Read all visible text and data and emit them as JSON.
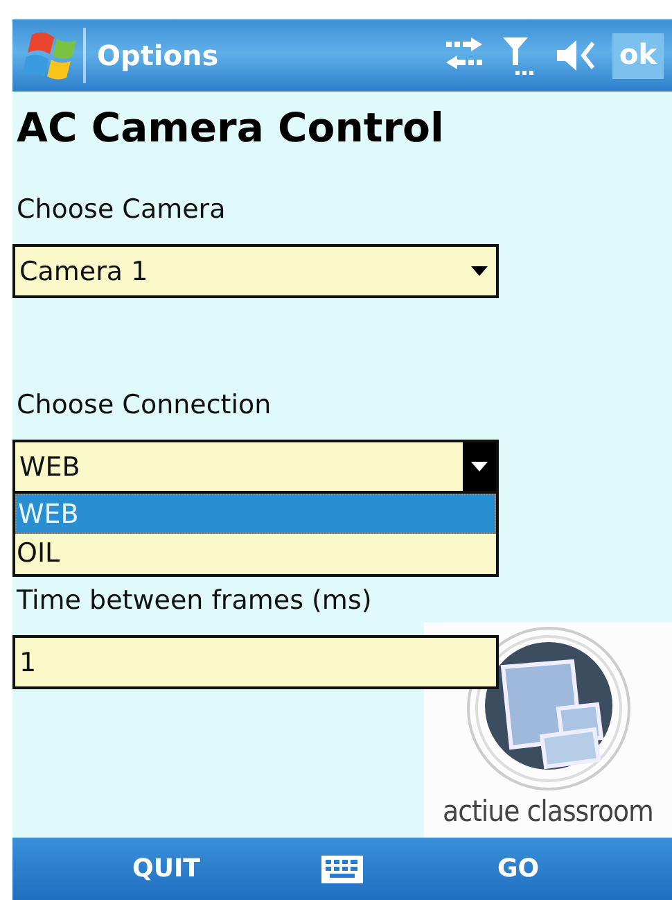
{
  "title_bar": {
    "title": "Options",
    "ok": "ok"
  },
  "heading": "AC Camera Control",
  "fields": [
    {
      "kind": "dropdown",
      "label": "Choose Camera",
      "value": "Camera 1",
      "expanded": false
    },
    {
      "kind": "dropdown",
      "label": "Choose Connection",
      "value": "WEB",
      "expanded": true,
      "options": [
        {
          "label": "WEB",
          "selected": true
        },
        {
          "label": "OIL",
          "selected": false
        }
      ]
    },
    {
      "kind": "text",
      "label": "Time between frames (ms)",
      "value": "1"
    }
  ],
  "logo": {
    "text": "actiue classroom"
  },
  "softkeys": {
    "left": "QUIT",
    "right": "GO"
  }
}
